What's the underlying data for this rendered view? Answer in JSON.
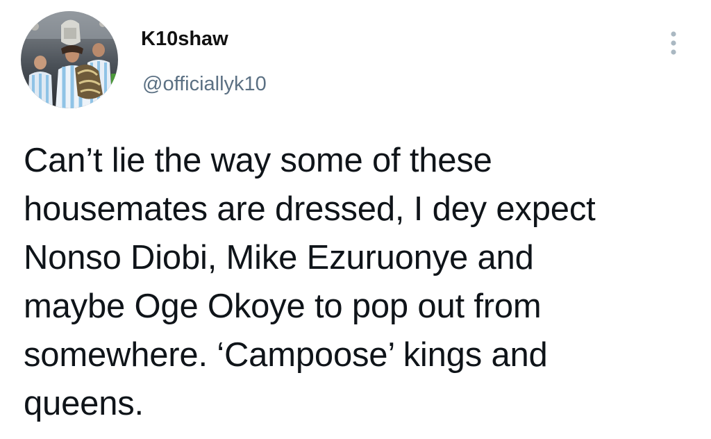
{
  "tweet": {
    "author": {
      "display_name": "K10shaw",
      "handle": "@officiallyk10",
      "avatar_icon": "profile-photo-icon"
    },
    "menu_icon": "more-vertical-icon",
    "text_lines": [
      "Can’t lie the way some of these",
      "housemates are dressed, I dey expect",
      "Nonso Diobi, Mike Ezuruonye and",
      "maybe Oge Okoye to pop out from",
      "somewhere. ‘Campoose’ kings and",
      "queens."
    ]
  },
  "colors": {
    "background": "#ffffff",
    "text": "#0f1419",
    "secondary_text": "#5b7083",
    "menu_dots": "#aab8c2"
  }
}
